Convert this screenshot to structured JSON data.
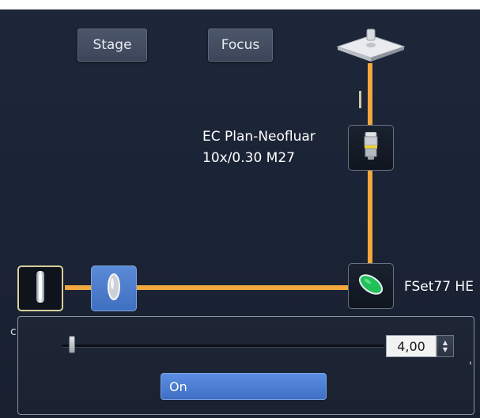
{
  "tabs": {
    "stage_label": "Stage",
    "focus_label": "Focus"
  },
  "components": {
    "stage_icon": "stage-plate-icon",
    "objective": {
      "icon": "objective-lens-icon",
      "name_line1": "EC Plan-Neofluar",
      "name_line2": "10x/0.30 M27"
    },
    "filter": {
      "icon": "reflector-filter-icon",
      "label": "FSet77 HE"
    },
    "lamp_icon": "lamp-icon",
    "lens_icon": "lens-icon"
  },
  "popup": {
    "intensity_value": "4,00",
    "intensity_level_fraction": 0.02,
    "on_button_label": "On"
  },
  "colors": {
    "beam": "#f2a83e",
    "panel_background": "#1d2739",
    "selected_border": "#d8cf9c",
    "active_blue": "#4a7acb",
    "filter_green": "#22c05a"
  }
}
